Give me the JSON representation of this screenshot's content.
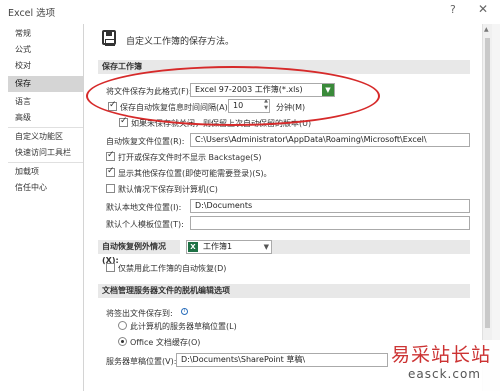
{
  "window": {
    "title": "Excel 选项",
    "help": "?",
    "close": "✕"
  },
  "nav": {
    "items": [
      "常规",
      "公式",
      "校对",
      "保存",
      "语言",
      "高级",
      "自定义功能区",
      "快速访问工具栏",
      "加载项",
      "信任中心"
    ],
    "active": "保存"
  },
  "header": {
    "title": "自定义工作簿的保存方法。",
    "icon": "save-icon"
  },
  "save_workbooks": {
    "section_title": "保存工作簿",
    "format_label": "将文件保存为此格式(F):",
    "format_value": "Excel 97-2003 工作簿(*.xls)",
    "autorecover_label": "保存自动恢复信息时间间隔(A)",
    "autorecover_checked": true,
    "autorecover_minutes": "10",
    "minutes_label": "分钟(M)",
    "keep_last_label": "如果未保存就关闭，则保留上次自动保留的版本(U)",
    "keep_last_checked": true,
    "autorecover_location_label": "自动恢复文件位置(R):",
    "autorecover_location_value": "C:\\Users\\Administrator\\AppData\\Roaming\\Microsoft\\Excel\\",
    "backstage_label": "打开或保存文件时不显示 Backstage(S)",
    "backstage_checked": true,
    "show_locations_label": "显示其他保存位置(即使可能需要登录)(S)。",
    "show_locations_checked": true,
    "save_to_computer_label": "默认情况下保存到计算机(C)",
    "save_to_computer_checked": false,
    "default_location_label": "默认本地文件位置(I):",
    "default_location_value": "D:\\Documents",
    "personal_templates_label": "默认个人模板位置(T):",
    "personal_templates_value": ""
  },
  "autorecover_exceptions": {
    "section_label": "自动恢复例外情况(X):",
    "workbook_value": "工作簿1",
    "disable_label": "仅禁用此工作簿的自动恢复(D)",
    "disable_checked": false
  },
  "offline_editing": {
    "section_title": "文档管理服务器文件的脱机编辑选项",
    "save_checked_out_label": "将签出文件保存到:",
    "option_server": "此计算机的服务器草稿位置(L)",
    "option_office_cache": "Office 文档缓存(O)",
    "selected": "Office 文档缓存(O)",
    "drafts_label": "服务器草稿位置(V):",
    "drafts_value": "D:\\Documents\\SharePoint 草稿\\"
  },
  "watermark": {
    "main": "易采站长站",
    "sub": "easck.com"
  },
  "colors": {
    "highlight": "#d62a2a",
    "excel_green": "#1e7145",
    "nav_active": "#d5d5d5"
  }
}
